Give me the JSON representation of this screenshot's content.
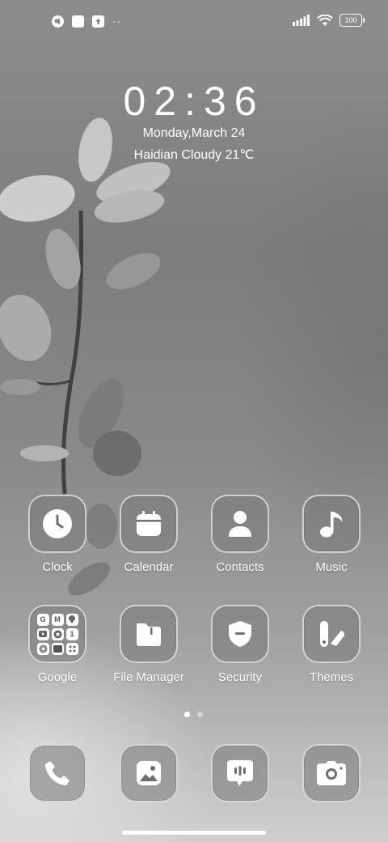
{
  "status_bar": {
    "left_icons": [
      "app-notification-icon",
      "square-notification-icon",
      "upload-notification-icon"
    ],
    "more_indicator": "··",
    "signal": "signal-bars-icon",
    "wifi": "wifi-icon",
    "battery": "100"
  },
  "lockclock": {
    "time": "02:36",
    "date": "Monday,March 24",
    "weather": "Haidian Cloudy 21℃"
  },
  "apps_row1": [
    {
      "label": "Clock",
      "icon": "clock-icon"
    },
    {
      "label": "Calendar",
      "icon": "calendar-icon"
    },
    {
      "label": "Contacts",
      "icon": "contacts-icon"
    },
    {
      "label": "Music",
      "icon": "music-note-icon"
    }
  ],
  "apps_row2": [
    {
      "label": "Google",
      "icon": "google-folder-icon"
    },
    {
      "label": "File Manager",
      "icon": "folder-icon"
    },
    {
      "label": "Security",
      "icon": "shield-icon"
    },
    {
      "label": "Themes",
      "icon": "themes-icon"
    }
  ],
  "google_folder": {
    "cells": [
      "G",
      "M",
      "",
      "",
      "",
      "1",
      "",
      "",
      ""
    ]
  },
  "page_indicator": {
    "pages": 2,
    "current": 1
  },
  "dock": [
    {
      "icon": "phone-icon"
    },
    {
      "icon": "gallery-icon"
    },
    {
      "icon": "messages-icon"
    },
    {
      "icon": "camera-icon"
    }
  ],
  "colors": {
    "accent": "#ffffff",
    "icon_fill": "#6f6f6f"
  }
}
